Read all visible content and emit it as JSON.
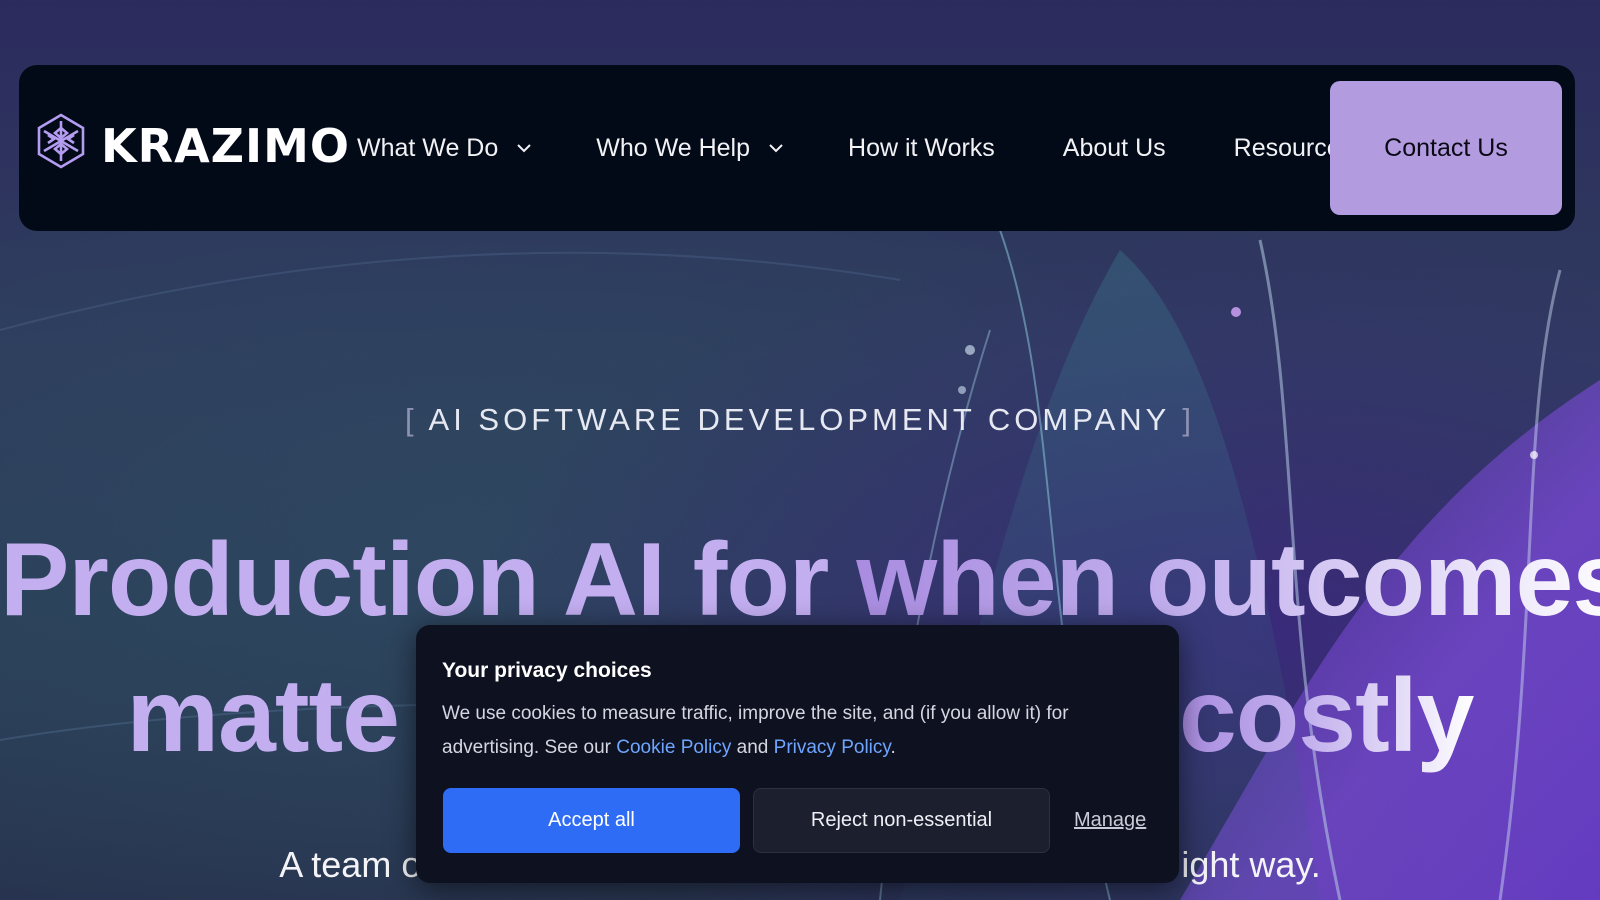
{
  "brand": {
    "name": "KRAZIMO",
    "accent_color": "#b39be0"
  },
  "nav": {
    "items": [
      {
        "label": "What We Do",
        "has_dropdown": true
      },
      {
        "label": "Who We Help",
        "has_dropdown": true
      },
      {
        "label": "How it Works",
        "has_dropdown": false
      },
      {
        "label": "About Us",
        "has_dropdown": false
      },
      {
        "label": "Resources",
        "has_dropdown": false
      }
    ],
    "cta_label": "Contact Us"
  },
  "hero": {
    "eyebrow_open": "[",
    "eyebrow": "AI SOFTWARE DEVELOPMENT COMPANY",
    "eyebrow_close": "]",
    "headline_line1_a": "Production AI for",
    "headline_line1_b": "when outcomes",
    "headline_line2_a": "matte",
    "headline_line2_b": "costly",
    "subline_a": "A team o",
    "subline_b": "ight way."
  },
  "cookie_banner": {
    "title": "Your privacy choices",
    "text_1": "We use cookies to measure traffic, improve the site, and (if you allow it) for advertising. See our ",
    "cookie_policy_link": "Cookie Policy",
    "text_and": " and ",
    "privacy_policy_link": "Privacy Policy",
    "text_end": ".",
    "accept_label": "Accept all",
    "reject_label": "Reject non-essential",
    "manage_label": "Manage",
    "accept_color": "#2f6cf6",
    "link_color": "#6ea6ff"
  }
}
